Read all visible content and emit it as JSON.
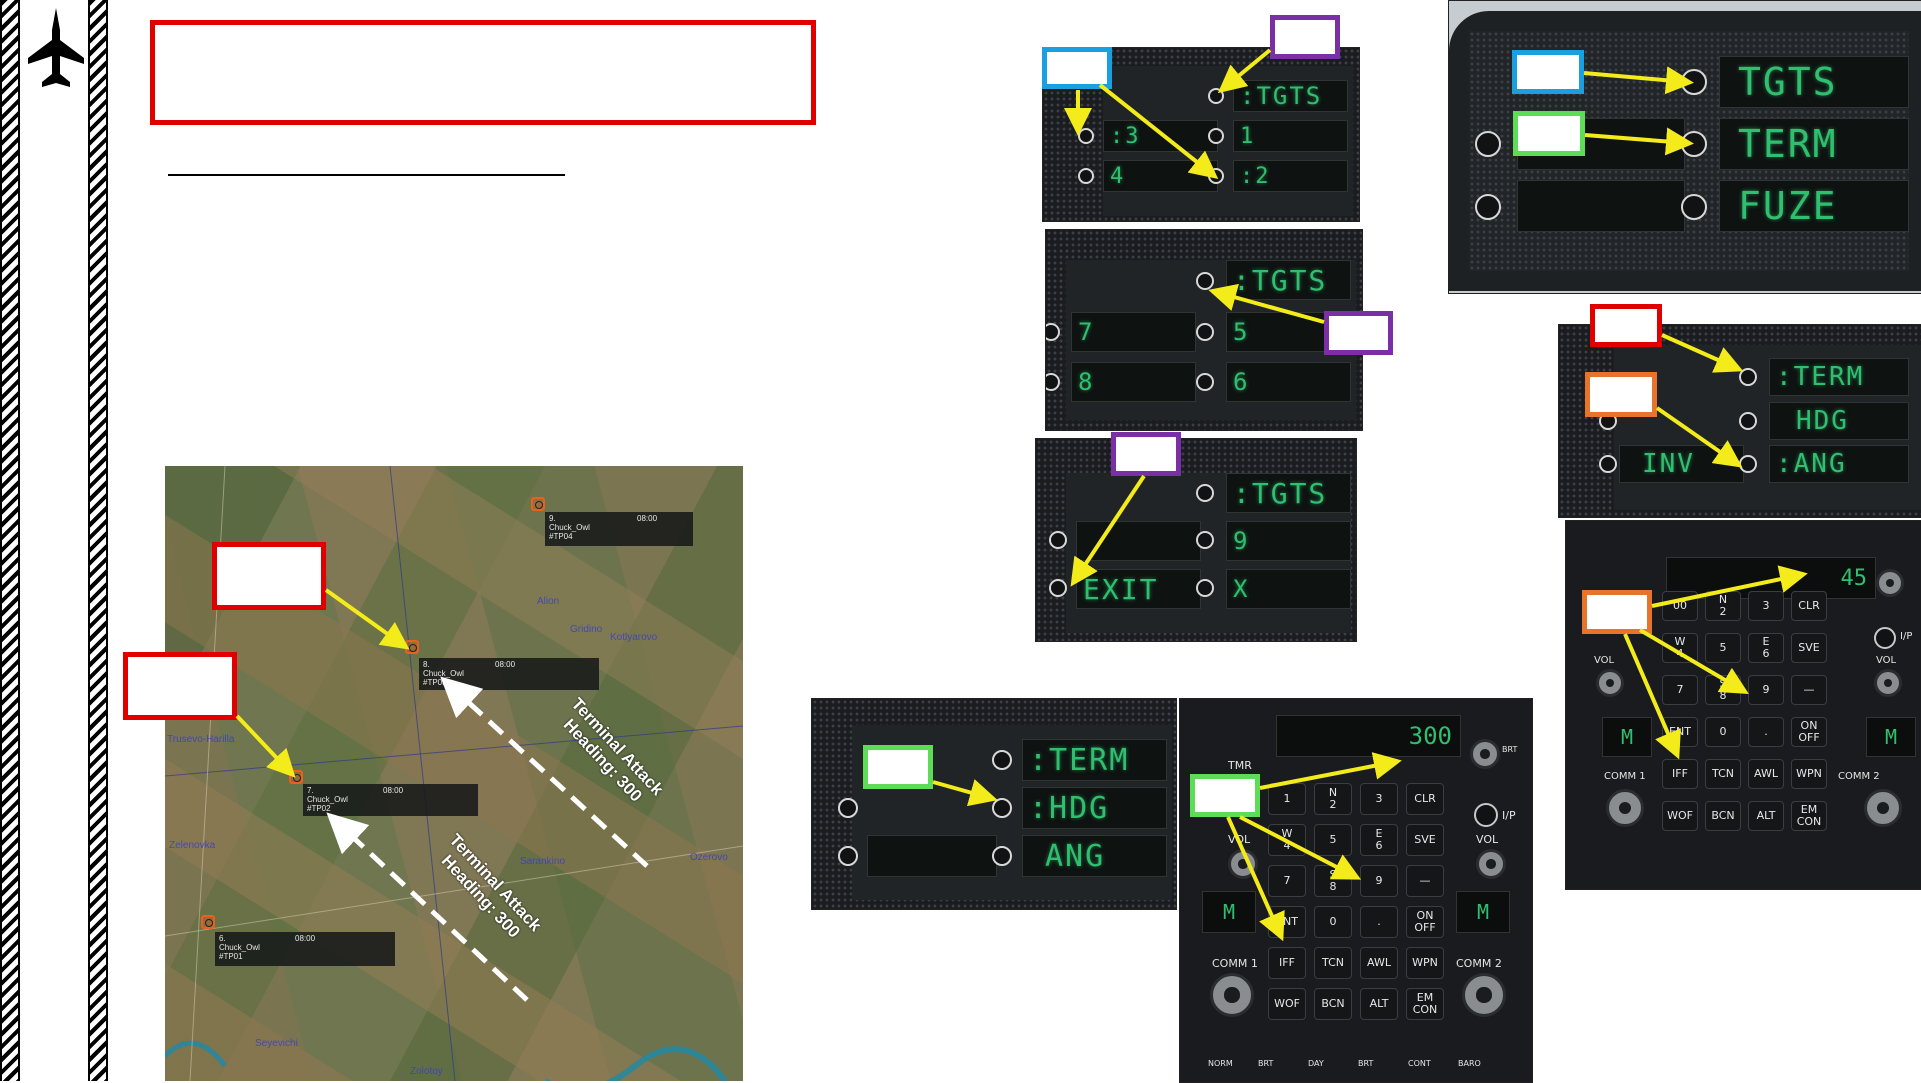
{
  "side_icon": "fighter-jet-icon",
  "colors": {
    "red": "#e00000",
    "blue": "#1aa0e0",
    "purple": "#7a2fa5",
    "green": "#5ddc55",
    "orange": "#e8742c",
    "yellow_arrow": "#f3ec1a",
    "lcd_green": "#2fbf6e"
  },
  "ufc_small_top": {
    "row1_right": ":TGTS",
    "row2_left": ":3",
    "row2_right": "1",
    "row3_left": "4",
    "row3_right": ":2"
  },
  "ufc_small_mid": {
    "row1_right": ":TGTS",
    "row2_left": "7",
    "row2_right": "5",
    "row3_left": "8",
    "row3_right": "6"
  },
  "ufc_small_bottom": {
    "row1_right": ":TGTS",
    "row2_right": "9",
    "row3_left": "EXIT",
    "row3_right": "X"
  },
  "ufc_large_top": {
    "row1": "TGTS",
    "row2": "TERM",
    "row3": "FUZE"
  },
  "ufc_term_right": {
    "row1": ":TERM",
    "row2": "HDG",
    "row3_left": "INV",
    "row3_right": ":ANG"
  },
  "ufc_term_left": {
    "row1": ":TERM",
    "row2": ":HDG",
    "row3": "ANG"
  },
  "keypad_center": {
    "display_value": "300",
    "tmr_label": "TMR",
    "iap_label": "I/P",
    "vol_label_left": "VOL",
    "vol_label_right": "VOL",
    "brt_label": "BRT",
    "comm1": "COMM 1",
    "comm2": "COMM 2",
    "comm_display": "M",
    "keys": [
      "1",
      "N\n2",
      "3",
      "CLR",
      "W\n4",
      "5",
      "E\n6",
      "SVE",
      "7",
      "S\n8",
      "9",
      "—",
      "ENT",
      "0",
      ".",
      "ON\nOFF",
      "IFF",
      "TCN",
      "AWL",
      "WPN",
      "WOF",
      "BCN",
      "ALT",
      "EM\nCON"
    ],
    "footer": [
      "NORM",
      "BRT",
      "DAY",
      "BRT",
      "CONT",
      "BARO"
    ]
  },
  "keypad_right": {
    "display_value": "45",
    "iap_label": "I/P",
    "vol_label_left": "VOL",
    "vol_label_right": "VOL",
    "comm1": "COMM 1",
    "comm2": "COMM 2",
    "comm_display": "M",
    "keys": [
      "00",
      "N\n2",
      "3",
      "CLR",
      "W\n4",
      "5",
      "E\n6",
      "SVE",
      "7",
      "S\n8",
      "9",
      "—",
      "ENT",
      "0",
      ".",
      "ON\nOFF",
      "IFF",
      "TCN",
      "AWL",
      "WPN",
      "WOF",
      "BCN",
      "ALT",
      "EM\nCON"
    ]
  },
  "map": {
    "waypoints": [
      {
        "name": "9.\nChuck_Owl\n#TP04",
        "time": "08:00"
      },
      {
        "name": "8.\nChuck_Owl\n#TP03",
        "time": "08:00"
      },
      {
        "name": "7.\nChuck_Owl\n#TP02",
        "time": "08:00"
      },
      {
        "name": "6.\nChuck_Owl\n#TP01",
        "time": "08:00"
      }
    ],
    "towns": [
      "Alion",
      "Gridino",
      "Kotlyarovo",
      "Trusevo-Harilla",
      "Zelenovka",
      "Sarankino",
      "Ozerovo",
      "Seyevichi",
      "Zolotoy"
    ],
    "annotation_upper": "Terminal Attack\nHeading: 300",
    "annotation_lower": "Terminal Attack\nHeading: 300"
  }
}
